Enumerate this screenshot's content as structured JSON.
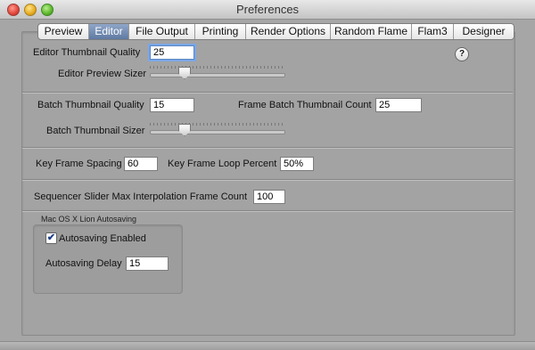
{
  "window": {
    "title": "Preferences"
  },
  "tabs": [
    {
      "label": "Preview",
      "active": false
    },
    {
      "label": "Editor",
      "active": true
    },
    {
      "label": "File Output",
      "active": false
    },
    {
      "label": "Printing",
      "active": false
    },
    {
      "label": "Render Options",
      "active": false
    },
    {
      "label": "Random Flame",
      "active": false
    },
    {
      "label": "Flam3",
      "active": false
    },
    {
      "label": "Designer",
      "active": false
    }
  ],
  "help": {
    "label": "?"
  },
  "editor": {
    "thumbnail_quality_label": "Editor Thumbnail Quality",
    "thumbnail_quality_value": "25",
    "preview_sizer_label": "Editor Preview Sizer",
    "preview_sizer_level": 0.25
  },
  "batch": {
    "thumbnail_quality_label": "Batch Thumbnail Quality",
    "thumbnail_quality_value": "15",
    "frame_count_label": "Frame Batch Thumbnail Count",
    "frame_count_value": "25",
    "sizer_label": "Batch Thumbnail Sizer",
    "sizer_level": 0.25
  },
  "keyframe": {
    "spacing_label": "Key Frame Spacing",
    "spacing_value": "60",
    "loop_percent_label": "Key Frame Loop Percent",
    "loop_percent_value": "50%"
  },
  "sequencer": {
    "interp_label": "Sequencer Slider Max Interpolation Frame Count",
    "interp_value": "100"
  },
  "autosave": {
    "group_title": "Mac OS X Lion Autosaving",
    "enabled_label": "Autosaving Enabled",
    "enabled": true,
    "delay_label": "Autosaving Delay",
    "delay_value": "15"
  }
}
